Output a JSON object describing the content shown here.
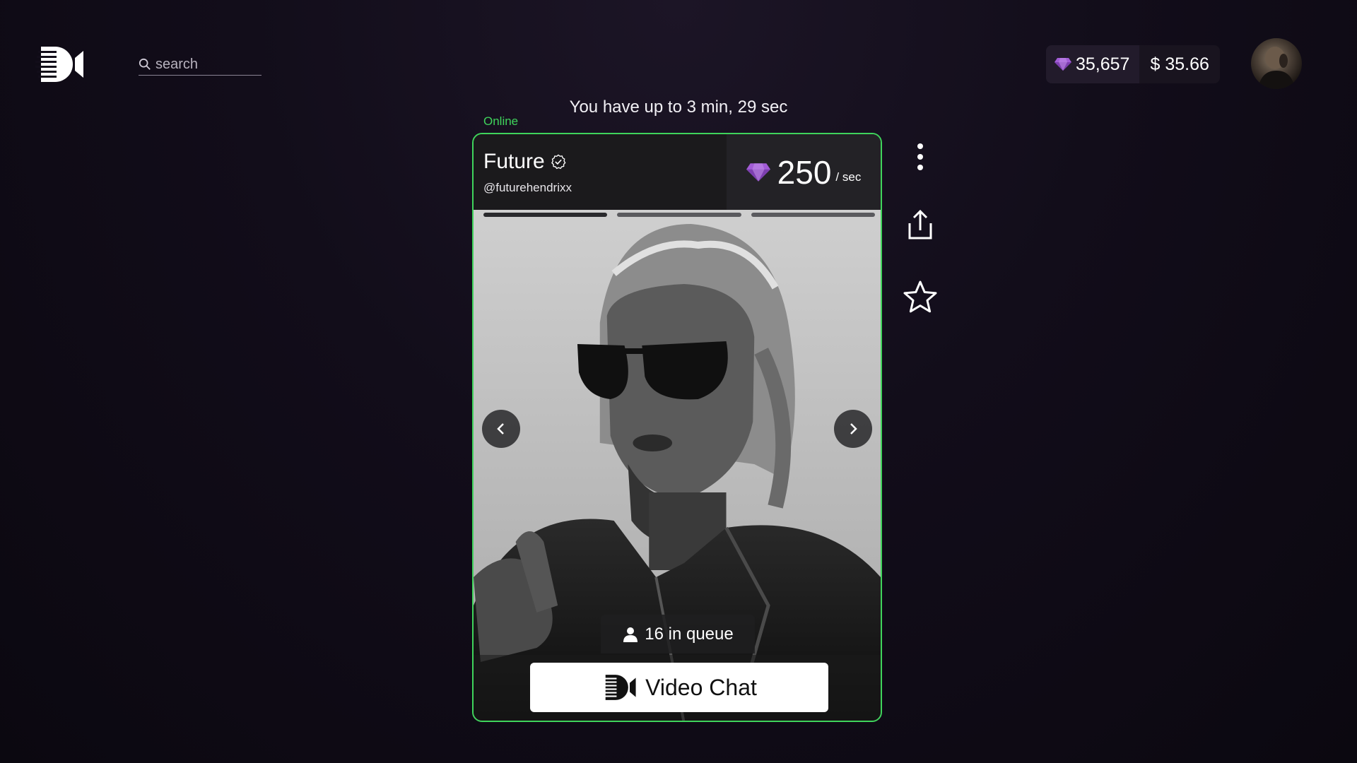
{
  "header": {
    "logo_icon": "video-camera-logo-icon",
    "search": {
      "placeholder": "search",
      "value": ""
    },
    "wallet": {
      "gems": "35,657",
      "usd": "$ 35.66",
      "gem_color": "#a25cd6"
    }
  },
  "call": {
    "time_notice": "You have up to 3 min, 29 sec",
    "status": "Online",
    "status_color": "#3fd45b"
  },
  "creator": {
    "name": "Future",
    "handle": "@futurehendrixx",
    "verified": true,
    "rate": {
      "value": "250",
      "unit": "/ sec"
    },
    "photos": {
      "total": 3,
      "current": 1
    },
    "queue": {
      "count": "16",
      "label": "in queue"
    },
    "cta_label": "Video Chat"
  },
  "side_actions": {
    "more_icon": "more-vertical-icon",
    "share_icon": "share-icon",
    "favorite_icon": "star-icon"
  }
}
